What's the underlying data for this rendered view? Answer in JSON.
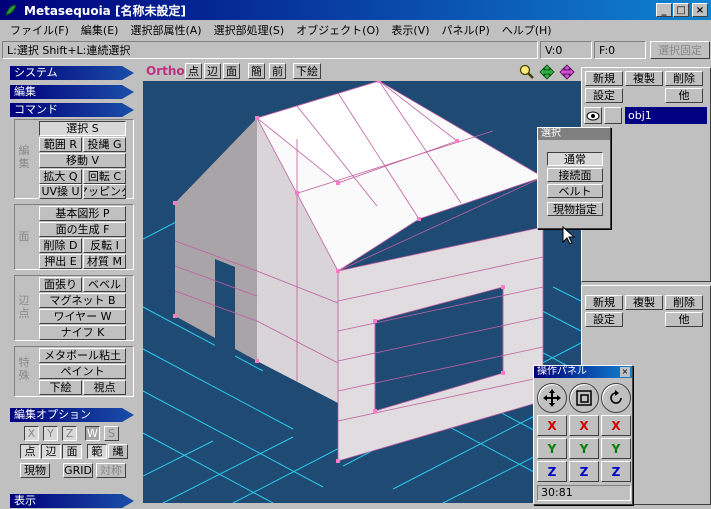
{
  "window": {
    "title": "Metasequoia [名称未設定]"
  },
  "menu": [
    "ファイル(F)",
    "編集(E)",
    "選択部属性(A)",
    "選択部処理(S)",
    "オブジェクト(O)",
    "表示(V)",
    "パネル(P)",
    "ヘルプ(H)"
  ],
  "status": {
    "hint": "L:選択  Shift+L:連続選択",
    "v": "V:0",
    "f": "F:0",
    "lock": "選択固定"
  },
  "left": {
    "system": "システム",
    "edit": "編集",
    "command": "コマンド",
    "group1_label": "編集",
    "group2_label": "面",
    "group3_label": "辺点",
    "group4_label": "特殊",
    "cmd": {
      "select": "選択 S",
      "range": "範囲 R",
      "lasso": "投縄 G",
      "move": "移動 V",
      "scale": "拡大 Q",
      "rotate": "回転 C",
      "uv": "UV操 U",
      "mapping": "マッピング",
      "primitive": "基本図形 P",
      "face_gen": "面の生成 F",
      "delete": "削除 D",
      "invert": "反転 I",
      "extrude": "押出 E",
      "material": "材質 M",
      "face_stretch": "面張り",
      "bevel": "ベベル",
      "magnet": "マグネット B",
      "wire": "ワイヤー W",
      "knife": "ナイフ K",
      "metaball": "メタボール粘土",
      "paint": "ペイント",
      "underlay": "下絵",
      "viewpoint": "視点"
    },
    "options_title": "編集オプション",
    "opt": {
      "x": "X",
      "y": "Y",
      "z": "Z",
      "w": "W",
      "s": "S",
      "point": "点",
      "edge": "辺",
      "face": "面",
      "range": "範",
      "lasso": "縄",
      "realobj": "現物",
      "grid": "GRID",
      "symm": "対称"
    },
    "display": "表示"
  },
  "viewport": {
    "mode": "Ortho",
    "buttons": [
      "点",
      "辺",
      "面",
      "簡",
      "前",
      "下絵"
    ]
  },
  "objpanel": {
    "new": "新規",
    "dup": "複製",
    "del": "削除",
    "settings": "設定",
    "other": "他",
    "object_name": "obj1"
  },
  "matpanel": {
    "new": "新規",
    "dup": "複製",
    "del": "削除",
    "settings": "設定",
    "other": "他"
  },
  "select_dialog": {
    "title": "選択",
    "normal": "通常",
    "connected": "接続面",
    "belt": "ベルト",
    "real": "現物指定"
  },
  "op_panel": {
    "title": "操作パネル",
    "x": "X",
    "y": "Y",
    "z": "Z",
    "readout": "30:81"
  },
  "colors": {
    "title_start": "#00007b",
    "title_end": "#1084d0",
    "viewport_bg": "#1e4a74",
    "selection": "#000080",
    "grid_line": "#29c8e8",
    "vertex": "#ff7ac8",
    "axis_x": "#d00000",
    "axis_y": "#008000",
    "axis_z": "#0000c8"
  }
}
